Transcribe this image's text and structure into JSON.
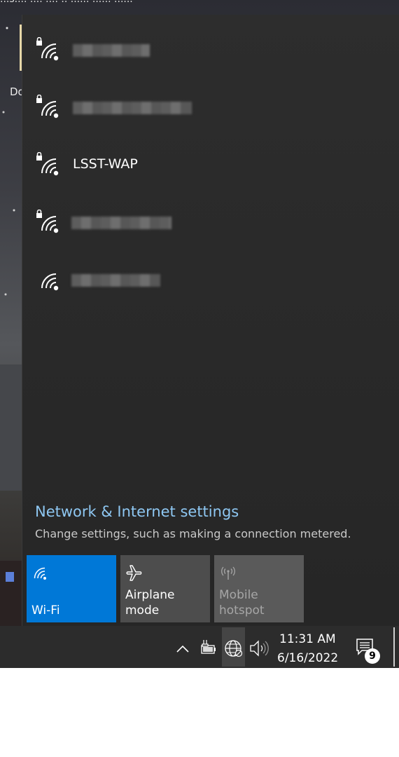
{
  "wallpaper": {
    "top_text": "...s.... .... .... .. ...... ...... ......",
    "desktop_label": "Do"
  },
  "networks": [
    {
      "name": "",
      "secured": true,
      "selected": true
    },
    {
      "name": "",
      "secured": true,
      "selected": false
    },
    {
      "name": "LSST-WAP",
      "secured": true,
      "selected": false
    },
    {
      "name": "",
      "secured": true,
      "selected": false
    },
    {
      "name": "",
      "secured": false,
      "selected": false
    }
  ],
  "settings": {
    "link": "Network & Internet settings",
    "description": "Change settings, such as making a connection metered."
  },
  "quick_actions": {
    "wifi": {
      "label": "Wi-Fi",
      "state": "on"
    },
    "airplane": {
      "label": "Airplane mode",
      "state": "off"
    },
    "hotspot": {
      "label_line1": "Mobile",
      "label_line2": "hotspot",
      "state": "disabled"
    }
  },
  "taskbar": {
    "time": "11:31 AM",
    "date": "6/16/2022",
    "notification_count": "9"
  },
  "colors": {
    "accent": "#0078d7",
    "link": "#8ec7f2",
    "panel": "#2b2b2b"
  },
  "icons": [
    "wifi-secured-icon",
    "wifi-open-icon",
    "airplane-icon",
    "hotspot-icon",
    "chevron-up-icon",
    "power-plug-icon",
    "globe-network-icon",
    "volume-icon",
    "action-center-icon"
  ]
}
